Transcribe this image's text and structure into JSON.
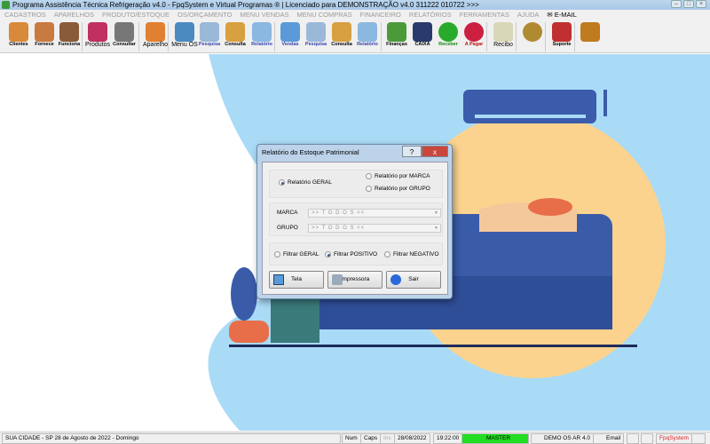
{
  "window": {
    "title": "Programa Assistência Técnica Refrigeração v4.0 - FpqSystem e Virtual Programas ® | Licenciado para  DEMONSTRAÇÃO v4.0 311222 010722 >>>"
  },
  "menu": [
    "CADASTROS",
    "APARELHOS",
    "PRODUTO/ESTOQUE",
    "OS/ORÇAMENTO",
    "MENU VENDAS",
    "MENU COMPRAS",
    "FINANCEIRO",
    "RELATÓRIOS",
    "FERRAMENTAS",
    "AJUDA",
    "E-MAIL"
  ],
  "toolbar": [
    {
      "label": "Clientes",
      "icon": "clients-icon",
      "color": "#d9893a"
    },
    {
      "label": "Fornece",
      "icon": "supplier-icon",
      "color": "#c97a40"
    },
    {
      "label": "Funciona",
      "icon": "employee-icon",
      "color": "#8a5a3a"
    },
    {
      "label": "Produtos",
      "icon": "products-icon",
      "color": "#c03060"
    },
    {
      "label": "Consultar",
      "icon": "barcode-icon",
      "color": "#777777"
    },
    {
      "label": "Aparelho",
      "icon": "appliance-icon",
      "color": "#e08030"
    },
    {
      "label": "Menu OS",
      "icon": "tools-icon",
      "color": "#4a8ac0"
    },
    {
      "label": "Pesquisa",
      "icon": "search-doc-icon",
      "color": "#9ab8d8"
    },
    {
      "label": "Consulta",
      "icon": "folder-icon",
      "color": "#d8a040"
    },
    {
      "label": "Relatório",
      "icon": "printer-icon",
      "color": "#8ab8e0"
    },
    {
      "label": "Vendas",
      "icon": "monitor-icon",
      "color": "#5a9ad8"
    },
    {
      "label": "Pesquisa",
      "icon": "search-doc-icon",
      "color": "#9ab8d8"
    },
    {
      "label": "Consulta",
      "icon": "folder-icon",
      "color": "#d8a040"
    },
    {
      "label": "Relatório",
      "icon": "printer-icon",
      "color": "#8ab8e0"
    },
    {
      "label": "Finanças",
      "icon": "finance-chart-icon",
      "color": "#4a9a3a"
    },
    {
      "label": "CAIXA",
      "icon": "cash-book-icon",
      "color": "#2a3a6a"
    },
    {
      "label": "Receber",
      "icon": "receive-money-icon",
      "color": "#2aaa2a"
    },
    {
      "label": "A Pagar",
      "icon": "pay-money-icon",
      "color": "#cc2040"
    },
    {
      "label": "Recibo",
      "icon": "receipt-icon",
      "color": "#d8d8b8"
    },
    {
      "label": "",
      "icon": "coin-icon",
      "color": "#b08a30"
    },
    {
      "label": "Suporte",
      "icon": "support-icon",
      "color": "#c03030"
    },
    {
      "label": "",
      "icon": "exit-door-icon",
      "color": "#c07a20"
    }
  ],
  "dialog": {
    "title": "Relatório do Estoque Patrimonial",
    "report_type": {
      "options": [
        "Relatório GERAL",
        "Relatório por MARCA",
        "Relatório por GRUPO"
      ],
      "selected": "Relatório GERAL"
    },
    "marca": {
      "label": "MARCA",
      "value": ">> T O D O S <<"
    },
    "grupo": {
      "label": "GRUPO",
      "value": ">> T O D O S <<"
    },
    "filter": {
      "options": [
        "Filtrar GERAL",
        "Filtrar POSITIVO",
        "Filtrar NEGATIVO"
      ],
      "selected": "Filtrar POSITIVO"
    },
    "buttons": {
      "tela": "Tela",
      "impressora": "Impressora",
      "sair": "Sair"
    },
    "help": "?",
    "close": "x"
  },
  "status": {
    "city_date": "SUA CIDADE - SP 28 de Agosto de 2022 - Domingo",
    "num": "Num",
    "caps": "Caps",
    "ins": "Ins",
    "date": "28/08/2022",
    "time": "19:22:00",
    "user": "MASTER",
    "version": "DEMO OS AR 4.0",
    "email": "Email",
    "brand": "FpqSystem",
    "user_color": "#22dd22"
  }
}
